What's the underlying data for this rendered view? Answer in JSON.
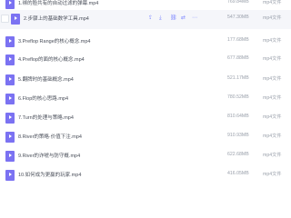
{
  "files": [
    {
      "name": "1.绑的脸共有的自动过滤的弹幕.mp4",
      "size": "769.84MB",
      "type": "mp4文件",
      "partial": true
    },
    {
      "name": "2.步骤上的基础数学工具.mp4",
      "size": "547.30MB",
      "type": "mp4文件",
      "highlight": true
    },
    {
      "name": "3.Preflop Range的核心概念.mp4",
      "size": "177.68MB",
      "type": "mp4文件"
    },
    {
      "name": "4.Preflop的面的核心概念.mp4",
      "size": "677.88MB",
      "type": "mp4文件"
    },
    {
      "name": "5.翻牌时的基础概念.mp4",
      "size": "521.17MB",
      "type": "mp4文件"
    },
    {
      "name": "6.Flop的核心思路.mp4",
      "size": "780.52MB",
      "type": "mp4文件"
    },
    {
      "name": "7.Turn的处理与策略.mp4",
      "size": "810.64MB",
      "type": "mp4文件"
    },
    {
      "name": "8.River的策略·价值下注.mp4",
      "size": "910.93MB",
      "type": "mp4文件"
    },
    {
      "name": "9.River的诈唬与防守概.mp4",
      "size": "622.68MB",
      "type": "mp4文件"
    },
    {
      "name": "10.如何成为更赢的玩家.mp4",
      "size": "416.05MB",
      "type": "mp4文件"
    }
  ],
  "row_actions": [
    {
      "icon": "share-icon",
      "glyph": "⇪"
    },
    {
      "icon": "download-icon",
      "glyph": "⤓"
    },
    {
      "icon": "link-icon",
      "glyph": "⛓"
    },
    {
      "icon": "move-icon",
      "glyph": "⇄"
    },
    {
      "icon": "more-icon",
      "glyph": "⋯"
    }
  ]
}
